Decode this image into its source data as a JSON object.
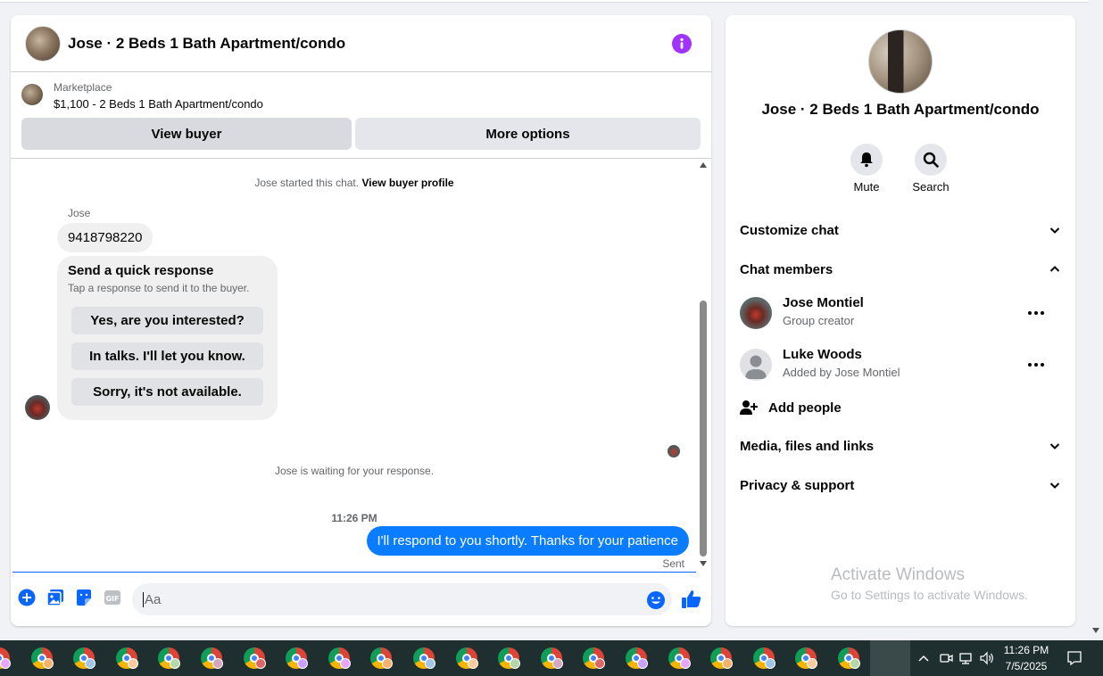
{
  "chat": {
    "title": "Jose · 2 Beds 1 Bath Apartment/condo",
    "listing_source": "Marketplace",
    "listing_desc": "$1,100 - 2 Beds 1 Bath Apartment/condo",
    "view_buyer_label": "View buyer",
    "more_options_label": "More options",
    "started_text": "Jose started this chat.",
    "view_profile_link": "View buyer profile",
    "sender_name": "Jose",
    "incoming_message": "9418798220",
    "quick_title": "Send a quick response",
    "quick_subtitle": "Tap a response to send it to the buyer.",
    "quick_replies": [
      "Yes, are you interested?",
      "In talks. I'll let you know.",
      "Sorry, it's not available."
    ],
    "waiting_text": "Jose is waiting for your response.",
    "timestamp": "11:26 PM",
    "outgoing_message": "I'll respond to you shortly. Thanks for your patience",
    "sent_label": "Sent",
    "input_placeholder": "Aa"
  },
  "info": {
    "title": "Jose · 2 Beds 1 Bath Apartment/condo",
    "mute_label": "Mute",
    "search_label": "Search",
    "customize_label": "Customize chat",
    "members_label": "Chat members",
    "members": [
      {
        "name": "Jose Montiel",
        "role": "Group creator"
      },
      {
        "name": "Luke Woods",
        "role": "Added by Jose Montiel"
      }
    ],
    "add_people_label": "Add people",
    "media_label": "Media, files and links",
    "privacy_label": "Privacy & support",
    "watermark_title": "Activate Windows",
    "watermark_sub": "Go to Settings to activate Windows."
  },
  "taskbar": {
    "time": "11:26 PM",
    "date": "7/5/2025",
    "icon_names": [
      "chrome-icon"
    ]
  },
  "colors": {
    "accent": "#0a7cff",
    "info_icon": "#a033ff",
    "panel_bg": "#ffffff",
    "page_bg": "#f0f2f5",
    "taskbar_bg": "#1f2f2f"
  }
}
